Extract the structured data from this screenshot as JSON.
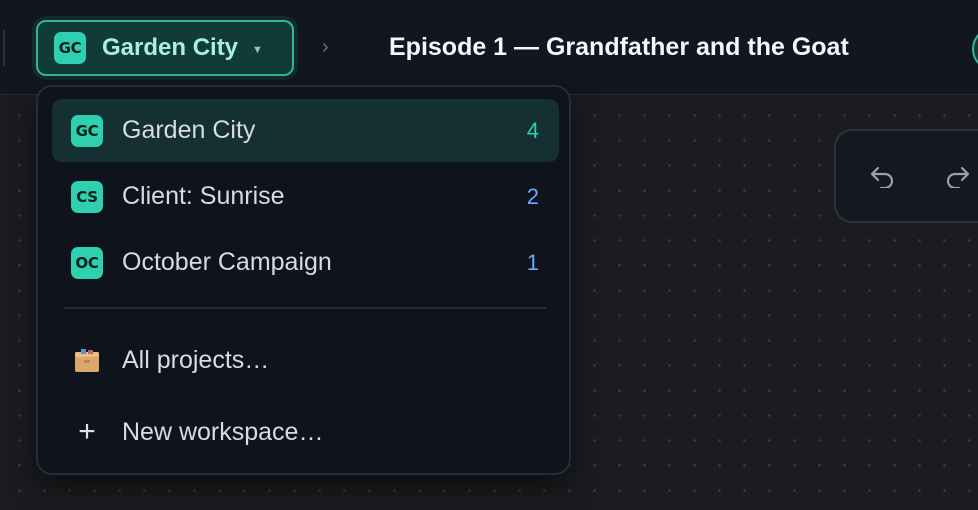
{
  "topbar": {
    "workspace": {
      "badge": "GC",
      "name": "Garden City",
      "caret_icon": "caret-down-icon"
    },
    "breadcrumb_separator": "›",
    "document_title": "Episode 1 — Grandfather and the Goat"
  },
  "history": {
    "undo_icon": "undo-icon",
    "redo_icon": "redo-icon"
  },
  "dropdown": {
    "workspaces": [
      {
        "badge": "GC",
        "name": "Garden City",
        "count": "4",
        "active": true,
        "count_color": "#2fd0b0"
      },
      {
        "badge": "CS",
        "name": "Client: Sunrise",
        "count": "2",
        "active": false,
        "count_color": "#6ea8f5"
      },
      {
        "badge": "OC",
        "name": "October Campaign",
        "count": "1",
        "active": false,
        "count_color": "#6ea8f5"
      }
    ],
    "actions": [
      {
        "icon": "folder-box-icon",
        "label": "All projects…"
      },
      {
        "icon": "plus-icon",
        "label": "New workspace…"
      }
    ]
  },
  "colors": {
    "accent": "#2fd0b0",
    "accent_border": "#2fb89c",
    "topbar_bg": "#121620",
    "menu_bg": "#0f131c"
  }
}
